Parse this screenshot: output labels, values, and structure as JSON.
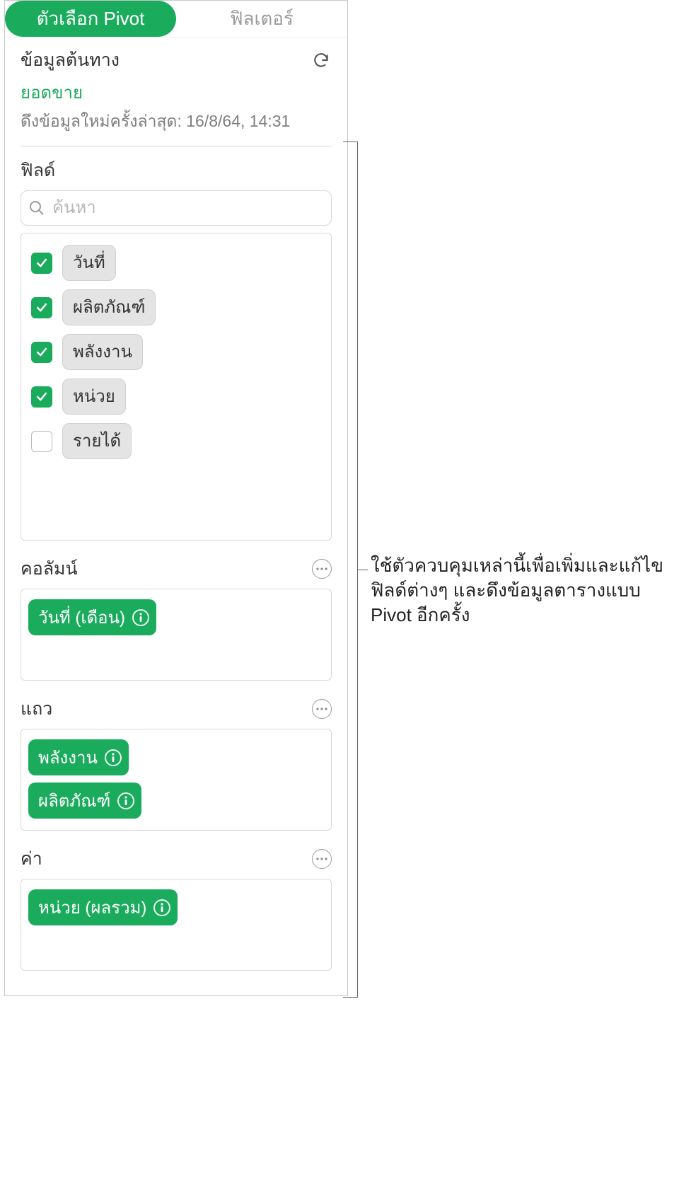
{
  "tabs": {
    "pivot": "ตัวเลือก Pivot",
    "filter": "ฟิลเตอร์"
  },
  "source": {
    "title": "ข้อมูลต้นทาง",
    "name": "ยอดขาย",
    "ts": "ดึงข้อมูลใหม่ครั้งล่าสุด: 16/8/64, 14:31"
  },
  "fields": {
    "title": "ฟิลด์",
    "placeholder": "ค้นหา",
    "items": [
      {
        "label": "วันที่",
        "checked": true
      },
      {
        "label": "ผลิตภัณฑ์",
        "checked": true
      },
      {
        "label": "พลังงาน",
        "checked": true
      },
      {
        "label": "หน่วย",
        "checked": true
      },
      {
        "label": "รายได้",
        "checked": false
      }
    ]
  },
  "zones": {
    "columns": {
      "title": "คอลัมน์",
      "items": [
        "วันที่ (เดือน)"
      ]
    },
    "rows": {
      "title": "แถว",
      "items": [
        "พลังงาน",
        "ผลิตภัณฑ์"
      ]
    },
    "values": {
      "title": "ค่า",
      "items": [
        "หน่วย (ผลรวม)"
      ]
    }
  },
  "callout": "ใช้ตัวควบคุมเหล่านี้เพื่อเพิ่มและแก้ไขฟิลด์ต่างๆ และดึงข้อมูลตารางแบบ Pivot อีกครั้ง"
}
